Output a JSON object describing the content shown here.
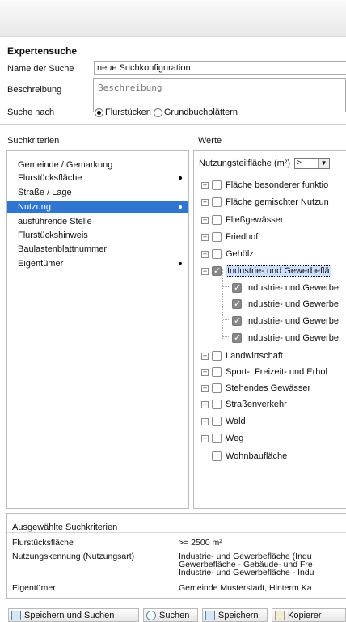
{
  "header": {
    "title": "Expertensuche"
  },
  "form": {
    "name_label": "Name der Suche",
    "name_value": "neue Suchkonfiguration",
    "desc_label": "Beschreibung",
    "desc_placeholder": "Beschreibung",
    "search_by_label": "Suche nach",
    "option_flurstuecke": "Flurstücken",
    "option_grundbuch": "Grundbuchblättern"
  },
  "criteria": {
    "title": "Suchkriterien",
    "items": [
      {
        "label": "Gemeinde / Gemarkung"
      },
      {
        "label": "Flurstücksfläche"
      },
      {
        "label": "Straße / Lage"
      },
      {
        "label": "Nutzung"
      },
      {
        "label": "ausführende Stelle"
      },
      {
        "label": "Flurstückshinweis"
      },
      {
        "label": "Baulastenblattnummer"
      },
      {
        "label": "Eigentümer"
      }
    ]
  },
  "values": {
    "title": "Werte",
    "nutz_label": "Nutzungsteilfläche (m²)",
    "operator": ">",
    "tree": [
      {
        "label": "Fläche besonderer funktio"
      },
      {
        "label": "Fläche gemischter Nutzun"
      },
      {
        "label": "Fließgewässer"
      },
      {
        "label": "Friedhof"
      },
      {
        "label": "Gehölz"
      },
      {
        "label": "Industrie- und Gewerbeflä"
      },
      {
        "label": "Industrie- und Gewerbe"
      },
      {
        "label": "Industrie- und Gewerbe"
      },
      {
        "label": "Industrie- und Gewerbe"
      },
      {
        "label": "Industrie- und Gewerbe"
      },
      {
        "label": "Landwirtschaft"
      },
      {
        "label": "Sport-, Freizeit- und Erhol"
      },
      {
        "label": "Stehendes Gewässer"
      },
      {
        "label": "Straßenverkehr"
      },
      {
        "label": "Wald"
      },
      {
        "label": "Weg"
      },
      {
        "label": "Wohnbaufläche"
      }
    ]
  },
  "summary": {
    "title": "Ausgewählte Suchkriterien",
    "rows": [
      {
        "key": "Flurstücksfläche",
        "value": ">= 2500 m²"
      },
      {
        "key": "Nutzungskennung (Nutzungsart)",
        "value_lines": [
          "Industrie- und Gewerbefläche (Indu",
          "Gewerbefläche - Gebäude- und Fre",
          "Industrie- und Gewerbefläche - Indu"
        ]
      },
      {
        "key": "Eigentümer",
        "value": "Gemeinde Musterstadt, Hinterm Ka"
      }
    ]
  },
  "buttons": {
    "save_search": "Speichern und Suchen",
    "search": "Suchen",
    "save": "Speichern",
    "copy": "Kopierer"
  },
  "colors": {
    "selection": "#2e76cf",
    "border": "#bdbdbd"
  }
}
